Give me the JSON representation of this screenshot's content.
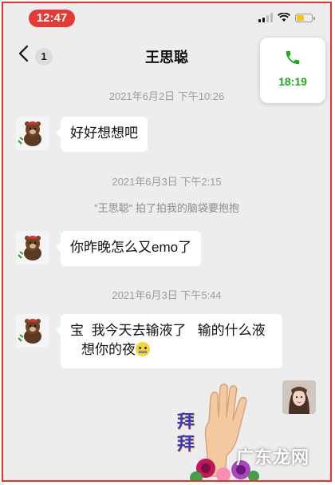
{
  "status_bar": {
    "time": "12:47",
    "battery_color": "#f5c518",
    "pill_color": "#e53a33"
  },
  "nav": {
    "back_icon": "chevron-left-icon",
    "unread_badge": "1",
    "title": "王思聪"
  },
  "call_widget": {
    "icon": "phone-icon",
    "duration": "18:19",
    "accent": "#1aad19"
  },
  "messages": [
    {
      "timestamp": "2021年6月2日 下午10:26",
      "text": "好好想想吧"
    },
    {
      "timestamp": "2021年6月3日 下午2:15",
      "system": "\"王思聪\" 拍了拍我的脑袋要抱抱",
      "text": "你昨晚怎么又emo了"
    },
    {
      "timestamp": "2021年6月3日 下午5:44",
      "line1": "宝  我今天去输液了   输的什么液",
      "line2": "想你的夜"
    }
  ],
  "sticker": {
    "text_line1": "拜",
    "text_line2": "拜"
  },
  "watermark": "广东龙网"
}
